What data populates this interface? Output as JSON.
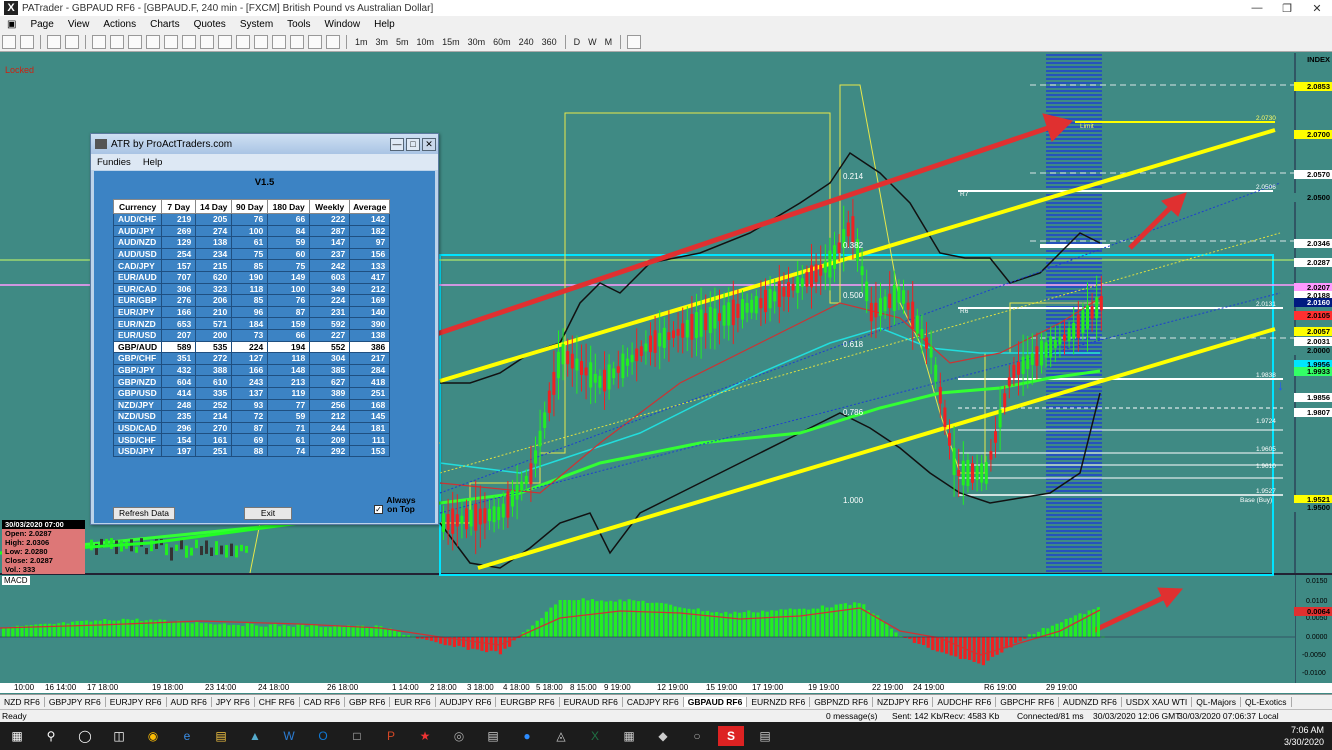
{
  "window": {
    "title": "PATrader - GBPAUD RF6 - [GBPAUD.F, 240 min - [FXCM] British Pound vs Australian Dollar]",
    "menu": [
      "Page",
      "View",
      "Actions",
      "Charts",
      "Quotes",
      "System",
      "Tools",
      "Window",
      "Help"
    ]
  },
  "toolbar": {
    "timeframes": [
      "1m",
      "3m",
      "5m",
      "10m",
      "15m",
      "30m",
      "60m",
      "240",
      "360",
      "D",
      "W",
      "M"
    ]
  },
  "chart": {
    "locked_label": "Locked",
    "price_labels": [
      {
        "text": "INDEX"
      },
      {
        "text": "2.0853",
        "bg": "#ffff00"
      },
      {
        "text": "2.0700",
        "bg": "#ffff00"
      },
      {
        "text": "2.0570",
        "bg": "#ffffff"
      },
      {
        "text": "2.0500",
        "bg": "#3f8a84"
      },
      {
        "text": "2.0346",
        "bg": "#ffffff"
      },
      {
        "text": "2.0287",
        "bg": "#ffffff"
      },
      {
        "text": "2.0207",
        "bg": "#ff99ff"
      },
      {
        "text": "2.0188",
        "bg": "#ffffff"
      },
      {
        "text": "2.0160",
        "bg": "#001a80",
        "fg": "#ffffff"
      },
      {
        "text": "2.0105",
        "bg": "#ff3030"
      },
      {
        "text": "2.0057",
        "bg": "#ffff00"
      },
      {
        "text": "2.0031",
        "bg": "#ffffff"
      },
      {
        "text": "2.0000",
        "bg": "#3f8a84"
      },
      {
        "text": "1.9956",
        "bg": "#00e5ff"
      },
      {
        "text": "1.9933",
        "bg": "#33ff66"
      },
      {
        "text": "1.9856",
        "bg": "#ffffff"
      },
      {
        "text": "1.9807",
        "bg": "#ffffff"
      },
      {
        "text": "1.9521",
        "bg": "#ffff00"
      },
      {
        "text": "1.9500",
        "bg": "#3f8a84"
      }
    ],
    "fib_labels": [
      "0.214",
      "0.382",
      "0.500",
      "0.618",
      "0.786",
      "1.000"
    ],
    "level_labels": [
      "Limit",
      "R7",
      "R6",
      "2.0730",
      "2.0506",
      "2.0131",
      "1.9838",
      "1.9724",
      "1.9605",
      "1.9610",
      "1.9527",
      "Base (Buy)"
    ],
    "ohlc": {
      "date": "30/03/2020 07:00",
      "open": "Open: 2.0287",
      "high": "High: 2.0306",
      "low": "Low: 2.0280",
      "close": "Close: 2.0287",
      "vol": "Vol.: 333"
    },
    "macd_label": "MACD",
    "macd_prices": [
      "0.0150",
      "0.0100",
      "0.0064",
      "0.0050",
      "0.0000",
      "-0.0050",
      "-0.0100",
      "-0.0150"
    ]
  },
  "dialog": {
    "title": "ATR by ProActTraders.com",
    "menu": [
      "Fundies",
      "Help"
    ],
    "version": "V1.5",
    "columns": [
      "Currency",
      "7 Day",
      "14 Day",
      "90 Day",
      "180 Day",
      "Weekly",
      "Average"
    ],
    "rows": [
      [
        "AUD/CHF",
        "219",
        "205",
        "76",
        "66",
        "222",
        "142"
      ],
      [
        "AUD/JPY",
        "269",
        "274",
        "100",
        "84",
        "287",
        "182"
      ],
      [
        "AUD/NZD",
        "129",
        "138",
        "61",
        "59",
        "147",
        "97"
      ],
      [
        "AUD/USD",
        "254",
        "234",
        "75",
        "60",
        "237",
        "156"
      ],
      [
        "CAD/JPY",
        "157",
        "215",
        "85",
        "75",
        "242",
        "133"
      ],
      [
        "EUR/AUD",
        "707",
        "620",
        "190",
        "149",
        "603",
        "417"
      ],
      [
        "EUR/CAD",
        "306",
        "323",
        "118",
        "100",
        "349",
        "212"
      ],
      [
        "EUR/GBP",
        "276",
        "206",
        "85",
        "76",
        "224",
        "169"
      ],
      [
        "EUR/JPY",
        "166",
        "210",
        "96",
        "87",
        "231",
        "140"
      ],
      [
        "EUR/NZD",
        "653",
        "571",
        "184",
        "159",
        "592",
        "390"
      ],
      [
        "EUR/USD",
        "207",
        "200",
        "73",
        "66",
        "227",
        "138"
      ],
      [
        "GBP/AUD",
        "589",
        "535",
        "224",
        "194",
        "552",
        "386"
      ],
      [
        "GBP/CHF",
        "351",
        "272",
        "127",
        "118",
        "304",
        "217"
      ],
      [
        "GBP/JPY",
        "432",
        "388",
        "166",
        "148",
        "385",
        "284"
      ],
      [
        "GBP/NZD",
        "604",
        "610",
        "243",
        "213",
        "627",
        "418"
      ],
      [
        "GBP/USD",
        "414",
        "335",
        "137",
        "119",
        "389",
        "251"
      ],
      [
        "NZD/JPY",
        "248",
        "252",
        "93",
        "77",
        "256",
        "168"
      ],
      [
        "NZD/USD",
        "235",
        "214",
        "72",
        "59",
        "212",
        "145"
      ],
      [
        "USD/CAD",
        "296",
        "270",
        "87",
        "71",
        "244",
        "181"
      ],
      [
        "USD/CHF",
        "154",
        "161",
        "69",
        "61",
        "209",
        "111"
      ],
      [
        "USD/JPY",
        "197",
        "251",
        "88",
        "74",
        "292",
        "153"
      ]
    ],
    "selected_row": 11,
    "refresh_label": "Refresh Data",
    "exit_label": "Exit",
    "always_on_top_label": "Always on Top",
    "always_on_top_checked": true
  },
  "date_axis": [
    "10:00",
    "16 14:00",
    "17 18:00",
    "19 18:00",
    "23 14:00",
    "24 18:00",
    "26 18:00",
    "1 14:00",
    "2 18:00",
    "3 18:00",
    "4 18:00",
    "5 18:00",
    "8 15:00",
    "9 19:00",
    "12 19:00",
    "15 19:00",
    "17 19:00",
    "19 19:00",
    "22 19:00",
    "24 19:00",
    "R6 19:00",
    "29 19:00"
  ],
  "tabs": [
    "NZD RF6",
    "GBPJPY RF6",
    "EURJPY RF6",
    "AUD RF6",
    "JPY RF6",
    "CHF RF6",
    "CAD RF6",
    "GBP RF6",
    "EUR RF6",
    "AUDJPY RF6",
    "EURGBP RF6",
    "EURAUD RF6",
    "CADJPY RF6",
    "GBPAUD RF6",
    "EURNZD RF6",
    "GBPNZD RF6",
    "NZDJPY RF6",
    "AUDCHF RF6",
    "GBPCHF RF6",
    "AUDNZD RF6",
    "USDX XAU WTI",
    "QL-Majors",
    "QL-Exotics"
  ],
  "active_tab": "GBPAUD RF6",
  "status": {
    "ready": "Ready",
    "messages": "0 message(s)",
    "traffic": "Sent: 142 Kb/Recv: 4583 Kb",
    "connection": "Connected/81 ms",
    "time_gmt": "30/03/2020 12:06 GMT",
    "time_local": "30/03/2020 07:06:37 Local"
  },
  "taskbar": {
    "time": "7:06 AM",
    "date": "3/30/2020"
  }
}
